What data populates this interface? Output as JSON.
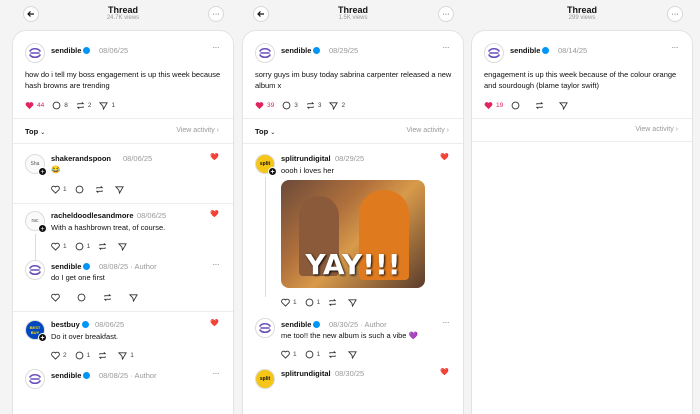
{
  "columns": [
    {
      "title": "Thread",
      "views": "24.7K views",
      "post": {
        "user": "sendible",
        "date": "08/06/25",
        "text": "how do i tell my boss engagement is up this week because hash browns are trending",
        "likes": "44",
        "replies": "8",
        "reposts": "2",
        "shares": "1"
      },
      "sort_label": "Top",
      "view_activity": "View activity",
      "replies": [
        {
          "user": "shakerandspoon",
          "date": "08/06/25",
          "text": "",
          "emoji": "😂",
          "likes": "1",
          "replies": "",
          "reposts": "",
          "shares": "",
          "avatar_text": "Sha"
        },
        {
          "user": "racheldoodlesandmore",
          "date": "08/06/25",
          "text": "With a hashbrown treat, of course.",
          "likes": "1",
          "replies": "1",
          "reposts": "",
          "shares": "",
          "avatar_text": "rac"
        },
        {
          "user": "sendible",
          "date": "08/08/25",
          "author": "Author",
          "text": "do I get one first",
          "likes": "",
          "replies": "",
          "reposts": "",
          "shares": ""
        },
        {
          "user": "bestbuy",
          "date": "08/06/25",
          "text": "Do it over breakfast.",
          "likes": "2",
          "replies": "1",
          "reposts": "",
          "shares": "1",
          "avatar_text": "BEST BUY"
        },
        {
          "user": "sendible",
          "date": "08/08/25",
          "author": "Author"
        }
      ]
    },
    {
      "title": "Thread",
      "views": "1.5K views",
      "post": {
        "user": "sendible",
        "date": "08/29/25",
        "text": "sorry guys im busy today sabrina carpenter released a new album x",
        "likes": "39",
        "replies": "3",
        "reposts": "3",
        "shares": "2"
      },
      "sort_label": "Top",
      "view_activity": "View activity",
      "replies": [
        {
          "user": "splitrundigital",
          "date": "08/29/25",
          "text": "oooh i loves her",
          "gif_caption": "YAY!!!",
          "likes": "1",
          "replies": "1",
          "reposts": "",
          "shares": "",
          "avatar_text": "split"
        },
        {
          "user": "sendible",
          "date": "08/30/25",
          "author": "Author",
          "text": "me too!! the new album is such a vibe 💜",
          "likes": "1",
          "replies": "1",
          "reposts": "",
          "shares": ""
        },
        {
          "user": "splitrundigital",
          "date": "08/30/25",
          "avatar_text": "split"
        }
      ]
    },
    {
      "title": "Thread",
      "views": "299 views",
      "post": {
        "user": "sendible",
        "date": "08/14/25",
        "text": "engagement is up this week because of the colour orange and sourdough (blame taylor swift)",
        "likes": "19",
        "replies": "",
        "reposts": "",
        "shares": ""
      },
      "view_activity": "View activity"
    }
  ],
  "colors": {
    "like": "#e0245e",
    "verified": "#0095f6",
    "brand": "#6b4fbb"
  }
}
